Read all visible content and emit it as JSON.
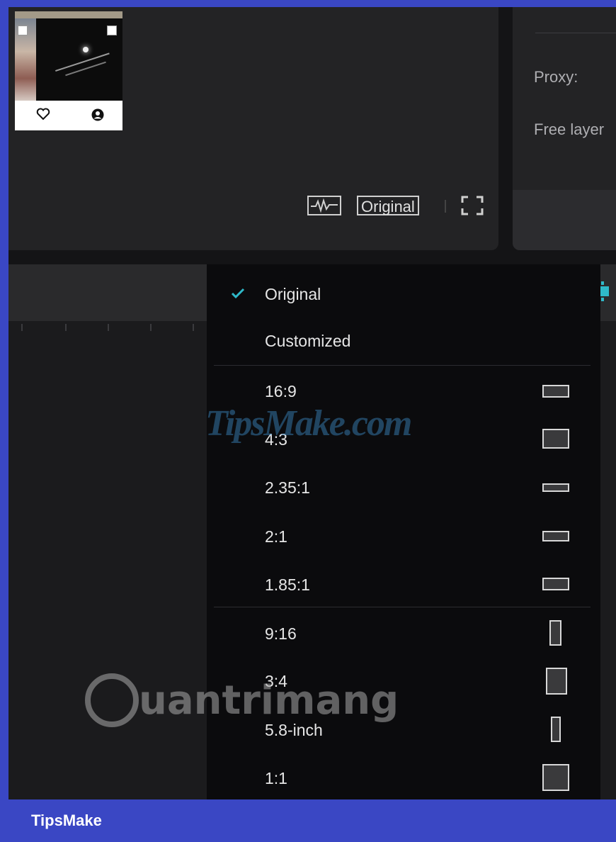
{
  "properties": {
    "proxy_label": "Proxy:",
    "free_layer_label": "Free layer"
  },
  "player": {
    "ratio_button_label": "Original"
  },
  "ratio_menu": {
    "top_items": [
      {
        "label": "Original",
        "checked": true
      },
      {
        "label": "Customized",
        "checked": false
      }
    ],
    "landscape": [
      {
        "label": "16:9",
        "icon": "ratio-16-9-icon"
      },
      {
        "label": "4:3",
        "icon": "ratio-4-3-icon"
      },
      {
        "label": "2.35:1",
        "icon": "ratio-2-35-1-icon"
      },
      {
        "label": "2:1",
        "icon": "ratio-2-1-icon"
      },
      {
        "label": "1.85:1",
        "icon": "ratio-1-85-1-icon"
      }
    ],
    "portrait": [
      {
        "label": "9:16",
        "icon": "ratio-9-16-icon"
      },
      {
        "label": "3:4",
        "icon": "ratio-3-4-icon"
      },
      {
        "label": "5.8-inch",
        "icon": "ratio-5-8-inch-icon"
      },
      {
        "label": "1:1",
        "icon": "ratio-1-1-icon"
      }
    ],
    "accent": "#2fb9c9"
  },
  "watermarks": {
    "tipsmake_logo": "TipsMake.com",
    "quantrimang_logo": "uantrimang"
  },
  "footer": {
    "brand": "TipsMake"
  }
}
